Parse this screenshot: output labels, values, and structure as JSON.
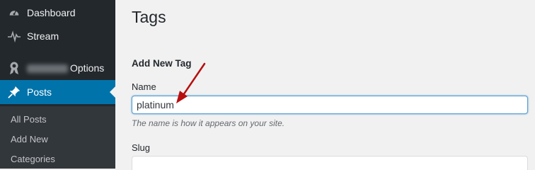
{
  "sidebar": {
    "items": [
      {
        "label": "Dashboard",
        "icon": "dashboard-icon"
      },
      {
        "label": "Stream",
        "icon": "stream-icon"
      },
      {
        "label": "Options",
        "icon": "award-icon"
      },
      {
        "label": "Posts",
        "icon": "pin-icon"
      }
    ],
    "submenu": [
      "All Posts",
      "Add New",
      "Categories"
    ]
  },
  "main": {
    "title": "Tags",
    "form": {
      "heading": "Add New Tag",
      "name_label": "Name",
      "name_value": "platinum",
      "name_help": "The name is how it appears on your site.",
      "slug_label": "Slug",
      "slug_value": ""
    }
  },
  "colors": {
    "sidebar_bg": "#23282d",
    "submenu_bg": "#32373c",
    "active_bg": "#0073aa",
    "page_bg": "#f1f1f1",
    "arrow": "#b80e0e"
  }
}
